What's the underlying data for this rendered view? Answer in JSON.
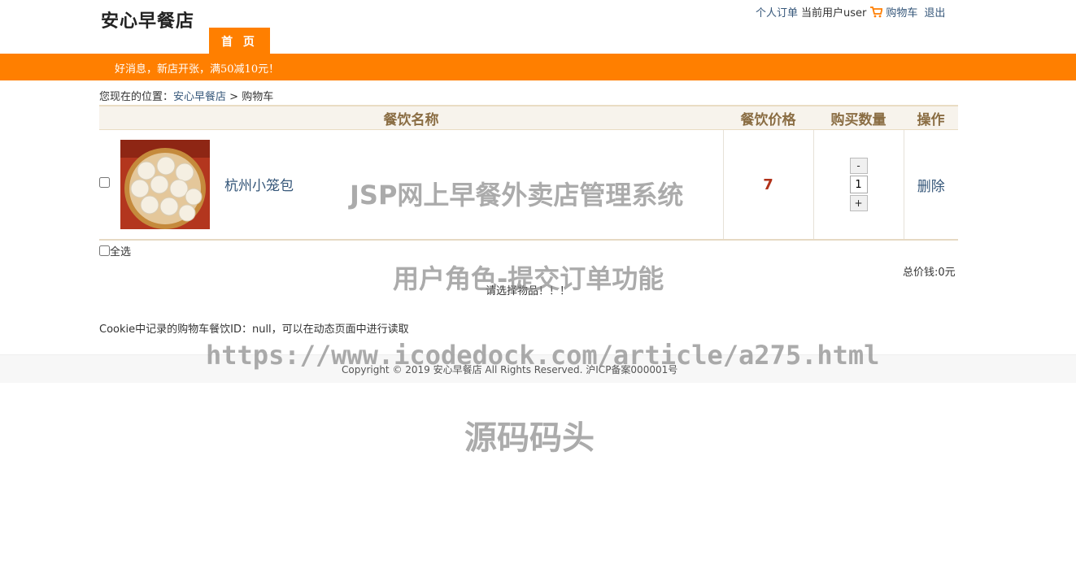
{
  "header": {
    "logo": "安心早餐店",
    "nav": {
      "orders": "个人订单",
      "current_user": "当前用户user",
      "cart": "购物车",
      "logout": "退出"
    },
    "home_tab": "首 页"
  },
  "banner": {
    "text": "好消息，新店开张，满50减10元！"
  },
  "breadcrumb": {
    "prefix": "您现在的位置：",
    "home": "安心早餐店",
    "separator": " > ",
    "current": "购物车"
  },
  "cart_table": {
    "headers": {
      "name": "餐饮名称",
      "price": "餐饮价格",
      "quantity": "购买数量",
      "action": "操作"
    },
    "rows": [
      {
        "name": "杭州小笼包",
        "price": "7",
        "quantity": "1",
        "minus": "-",
        "plus": "+",
        "delete": "删除"
      }
    ]
  },
  "select_all": "全选",
  "total": "总价钱:0元",
  "message": "请选择物品！！！",
  "cookie_note": "Cookie中记录的购物车餐饮ID：null，可以在动态页面中进行读取",
  "footer": {
    "copyright": "Copyright © 2019 安心早餐店 All Rights Reserved. 沪ICP备案000001号"
  },
  "watermarks": {
    "title": "JSP网上早餐外卖店管理系统",
    "subtitle": "用户角色-提交订单功能",
    "url": "https://www.icodedock.com/article/a275.html",
    "brand": "源码码头"
  },
  "colors": {
    "accent": "#ff7f00",
    "link": "#36577a",
    "price": "#b1321a",
    "header_text": "#8a6d43"
  },
  "icons": {
    "cart": "shopping-cart-icon"
  }
}
